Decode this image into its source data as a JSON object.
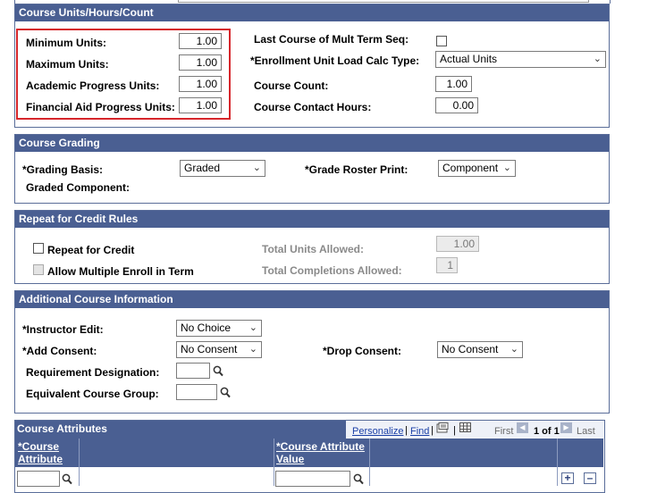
{
  "units_section": {
    "title": "Course Units/Hours/Count",
    "minimum_units_label": "Minimum Units:",
    "minimum_units": "1.00",
    "maximum_units_label": "Maximum Units:",
    "maximum_units": "1.00",
    "academic_progress_label": "Academic Progress Units:",
    "academic_progress": "1.00",
    "financial_aid_label": "Financial Aid Progress Units:",
    "financial_aid": "1.00",
    "last_course_label": "Last Course of Mult Term Seq:",
    "enrollment_calc_label": "*Enrollment Unit Load Calc Type:",
    "enrollment_calc_value": "Actual Units",
    "course_count_label": "Course Count:",
    "course_count": "1.00",
    "contact_hours_label": "Course Contact Hours:",
    "contact_hours": "0.00"
  },
  "grading_section": {
    "title": "Course Grading",
    "grading_basis_label": "*Grading Basis:",
    "grading_basis_value": "Graded",
    "grade_roster_label": "*Grade Roster Print:",
    "grade_roster_value": "Component",
    "graded_component_label": "Graded Component:"
  },
  "repeat_section": {
    "title": "Repeat for Credit Rules",
    "repeat_label": "Repeat for Credit",
    "multiple_enroll_label": "Allow Multiple Enroll in Term",
    "total_units_label": "Total Units Allowed:",
    "total_units": "1.00",
    "total_completions_label": "Total Completions Allowed:",
    "total_completions": "1"
  },
  "additional_section": {
    "title": "Additional Course Information",
    "instructor_edit_label": "*Instructor Edit:",
    "instructor_edit_value": "No Choice",
    "add_consent_label": "*Add Consent:",
    "add_consent_value": "No Consent",
    "drop_consent_label": "*Drop Consent:",
    "drop_consent_value": "No Consent",
    "requirement_label": "Requirement Designation:",
    "equivalent_label": "Equivalent Course Group:"
  },
  "attributes_grid": {
    "title": "Course Attributes",
    "personalize": "Personalize",
    "find": "Find",
    "first": "First",
    "range": "1 of 1",
    "last": "Last",
    "col_attribute_line1": "*Course",
    "col_attribute_line2": "Attribute",
    "col_value_line1": "*Course Attribute",
    "col_value_line2": "Value"
  },
  "colors": {
    "header_bg": "#4a5f92",
    "highlight_border": "#d6262b"
  }
}
